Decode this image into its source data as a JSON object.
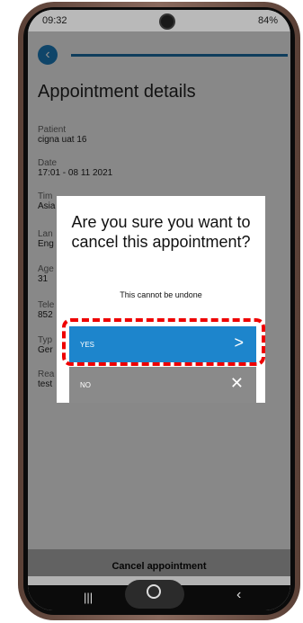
{
  "status_bar": {
    "time": "09:32",
    "right_text": "84%"
  },
  "page": {
    "title": "Appointment details",
    "fields": [
      {
        "label": "Patient",
        "value": "cigna uat 16"
      },
      {
        "label": "Date",
        "value": "17:01 - 08 11 2021"
      },
      {
        "label": "Tim",
        "value": "Asia"
      },
      {
        "label": "Lan",
        "value": "Eng"
      },
      {
        "label": "Age",
        "value": "31"
      },
      {
        "label": "Tele",
        "value": "852"
      },
      {
        "label": "Typ",
        "value": "Ger"
      },
      {
        "label": "Rea",
        "value": "test"
      }
    ],
    "cancel_label": "Cancel appointment"
  },
  "modal": {
    "question": "Are you sure you want to cancel this appointment?",
    "subtitle": "This cannot be undone",
    "yes_label": "YES",
    "no_label": "NO"
  },
  "colors": {
    "accent": "#1d85cc",
    "highlight": "#e00000",
    "no_button": "#8a8a8a"
  }
}
